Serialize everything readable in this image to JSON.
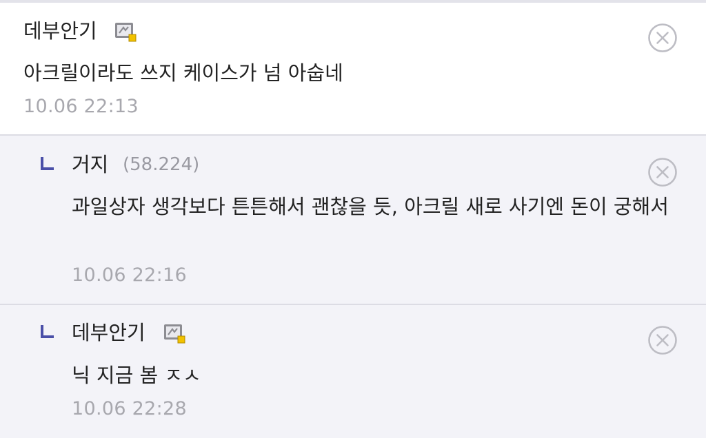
{
  "comments": [
    {
      "nickname": "데부안기",
      "ip": "",
      "text": "아크릴이라도 쓰지 케이스가 넘 아숩네",
      "time": "10.06 22:13",
      "is_reply": false,
      "has_gallog_icon": true
    },
    {
      "nickname": "거지",
      "ip": "(58.224)",
      "text": "과일상자 생각보다 튼튼해서 괜찮을 듯, 아크릴 새로 사기엔 돈이 궁해서",
      "time": "10.06 22:16",
      "is_reply": true,
      "has_gallog_icon": false
    },
    {
      "nickname": "데부안기",
      "ip": "",
      "text": "닉 지금 봄 ㅈㅅ",
      "time": "10.06 22:28",
      "is_reply": true,
      "has_gallog_icon": true
    }
  ],
  "icons": {
    "gallog": "fixed-member-gallog-icon",
    "delete": "close-circle-icon",
    "reply": "reply-arrow-icon"
  },
  "colors": {
    "reply_background": "#f3f3f8",
    "reply_mark": "#4a4fa8",
    "timestamp": "#a8a8ae",
    "ip": "#9a9aa2"
  }
}
